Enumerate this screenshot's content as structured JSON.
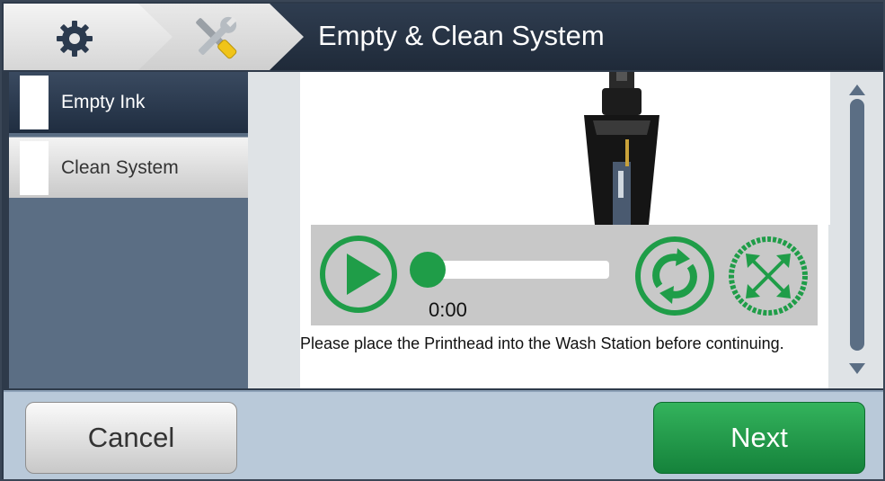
{
  "header": {
    "title": "Empty & Clean System",
    "breadcrumb": [
      {
        "icon": "gear-icon"
      },
      {
        "icon": "tools-icon"
      }
    ]
  },
  "sidebar": {
    "items": [
      {
        "label": "Empty Ink",
        "active": true
      },
      {
        "label": "Clean System",
        "active": false
      }
    ]
  },
  "video": {
    "time": "0:00",
    "progress": 0,
    "controls": [
      "play-icon",
      "replay-icon",
      "fullscreen-icon"
    ]
  },
  "instruction": "Please place the Printhead into the Wash Station before continuing.",
  "footer": {
    "cancel_label": "Cancel",
    "next_label": "Next"
  },
  "colors": {
    "accent_green": "#1f9d48",
    "header_dark": "#1f2a39",
    "sidebar_blue": "#5b6e84"
  }
}
